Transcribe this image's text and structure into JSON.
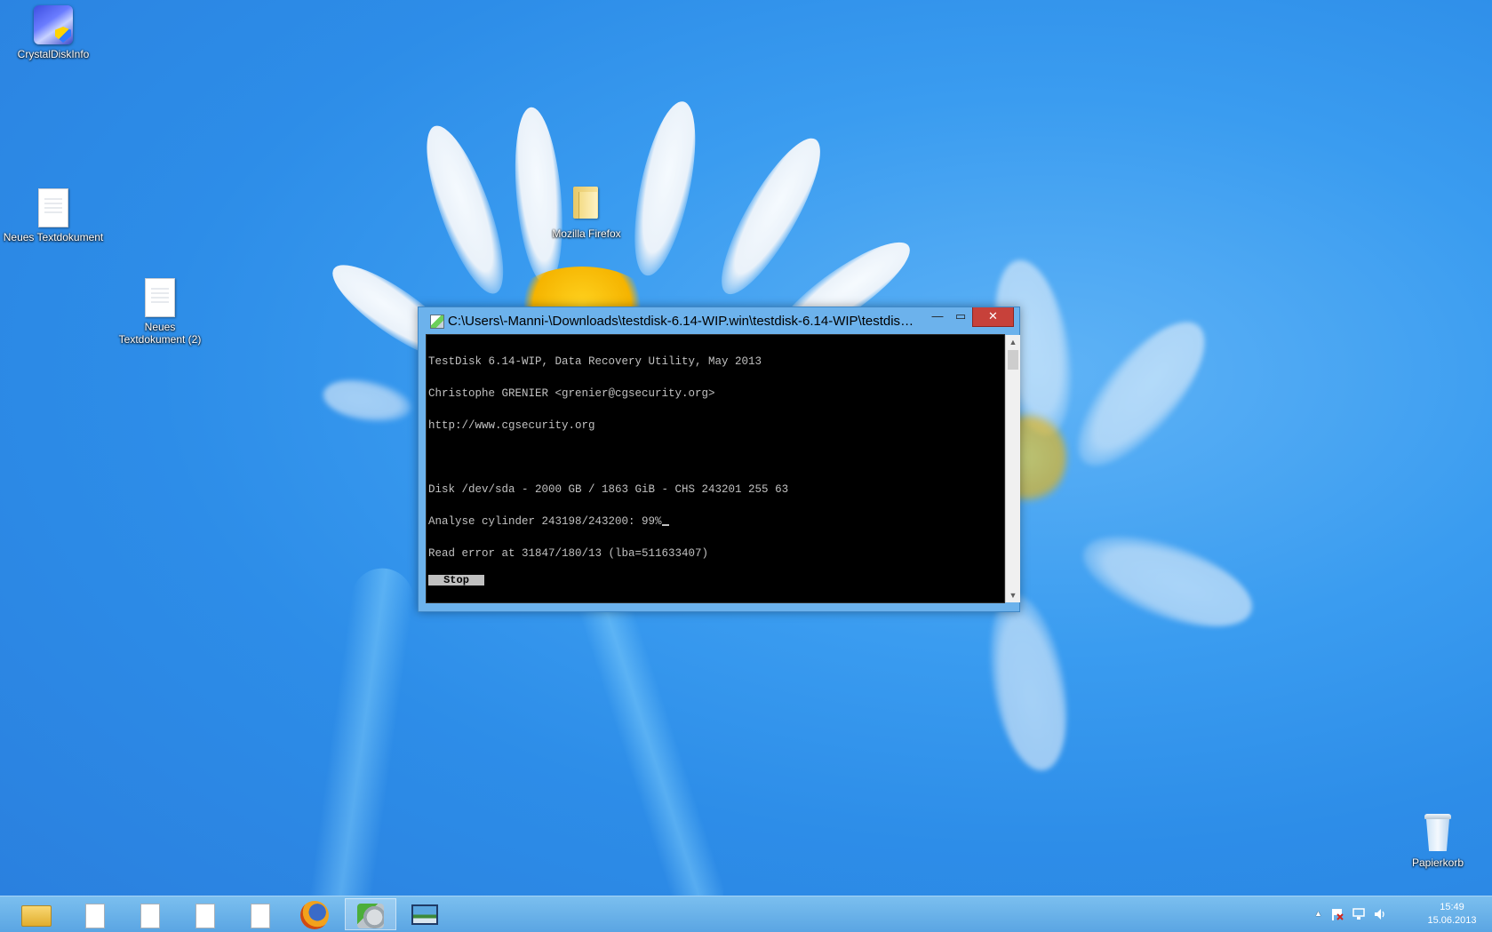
{
  "desktop": {
    "icons": [
      {
        "label": "CrystalDiskInfo",
        "icon": "crystaldiskinfo-icon"
      },
      {
        "label": "Neues Textdokument",
        "icon": "text-document-icon"
      },
      {
        "label": "Neues Textdokument (2)",
        "icon": "text-document-icon"
      },
      {
        "label": "Mozilla Firefox",
        "icon": "folder-icon"
      },
      {
        "label": "Papierkorb",
        "icon": "recycle-bin-icon"
      }
    ]
  },
  "console_window": {
    "title": "C:\\Users\\-Manni-\\Downloads\\testdisk-6.14-WIP.win\\testdisk-6.14-WIP\\testdisk_...",
    "minimize_glyph": "—",
    "maximize_glyph": "▭",
    "close_glyph": "✕",
    "lines": [
      "TestDisk 6.14-WIP, Data Recovery Utility, May 2013",
      "Christophe GRENIER <grenier@cgsecurity.org>",
      "http://www.cgsecurity.org",
      "",
      "Disk /dev/sda - 2000 GB / 1863 GiB - CHS 243201 255 63",
      "Analyse cylinder 243198/243200: 99%",
      "Read error at 31847/180/13 (lba=511633407)"
    ],
    "stop_label": "Stop",
    "scroll_up_glyph": "▲",
    "scroll_down_glyph": "▼"
  },
  "taskbar": {
    "items": [
      {
        "icon": "file-explorer-icon",
        "active": false
      },
      {
        "icon": "text-document-icon",
        "active": false
      },
      {
        "icon": "text-document-icon",
        "active": false
      },
      {
        "icon": "text-document-icon",
        "active": false
      },
      {
        "icon": "text-document-icon",
        "active": false
      },
      {
        "icon": "firefox-icon",
        "active": false
      },
      {
        "icon": "testdisk-icon",
        "active": true
      },
      {
        "icon": "photo-viewer-icon",
        "active": false
      }
    ],
    "tray": {
      "overflow_glyph": "▲",
      "icons": [
        "action-center-flag-icon",
        "network-icon",
        "volume-icon"
      ]
    },
    "clock": {
      "time": "15:49",
      "date": "15.06.2013"
    }
  },
  "colors": {
    "console_background": "#000000",
    "console_text": "#c0c0c0",
    "close_button": "#c7413a",
    "window_frame": "#6cb2ec",
    "taskbar": "#6db5ea"
  }
}
